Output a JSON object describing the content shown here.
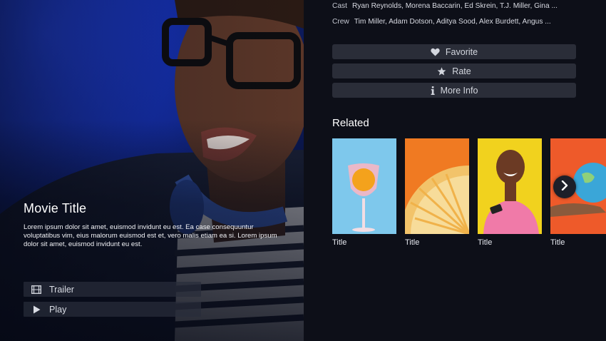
{
  "hero": {
    "title": "Movie Title",
    "description": "Lorem ipsum dolor sit amet, euismod invidunt eu est. Ea case consequuntur voluptatibus vim, eius malorum euismod est et, vero malis etiam ea si. Lorem ipsum dolor sit amet, euismod invidunt eu est.",
    "buttons": [
      {
        "label": "Trailer",
        "icon": "film-icon"
      },
      {
        "label": "Play",
        "icon": "play-icon"
      }
    ]
  },
  "credits": {
    "cast_label": "Cast",
    "cast_value": "Ryan Reynolds, Morena Baccarin, Ed Skrein, T.J. Miller, Gina ...",
    "crew_label": "Crew",
    "crew_value": "Tim Miller, Adam Dotson, Aditya Sood, Alex Burdett, Angus ..."
  },
  "actions": [
    {
      "label": "Favorite",
      "icon": "heart-icon"
    },
    {
      "label": "Rate",
      "icon": "star-icon"
    },
    {
      "label": "More Info",
      "icon": "info-icon"
    }
  ],
  "related": {
    "heading": "Related",
    "items": [
      {
        "title": "Title",
        "image": "cocktail-glass",
        "bg": "#7ec8ec"
      },
      {
        "title": "Title",
        "image": "citrus-slice",
        "bg": "#f07a22"
      },
      {
        "title": "Title",
        "image": "smiling-woman",
        "bg": "#f1d21e"
      },
      {
        "title": "Title",
        "image": "hand-globe",
        "bg": "#ee5a2a"
      }
    ],
    "next_icon": "chevron-right-icon"
  },
  "colors": {
    "background": "#0d0f18",
    "button": "#2a2d38",
    "hero_blue": "#1f3fd6"
  }
}
